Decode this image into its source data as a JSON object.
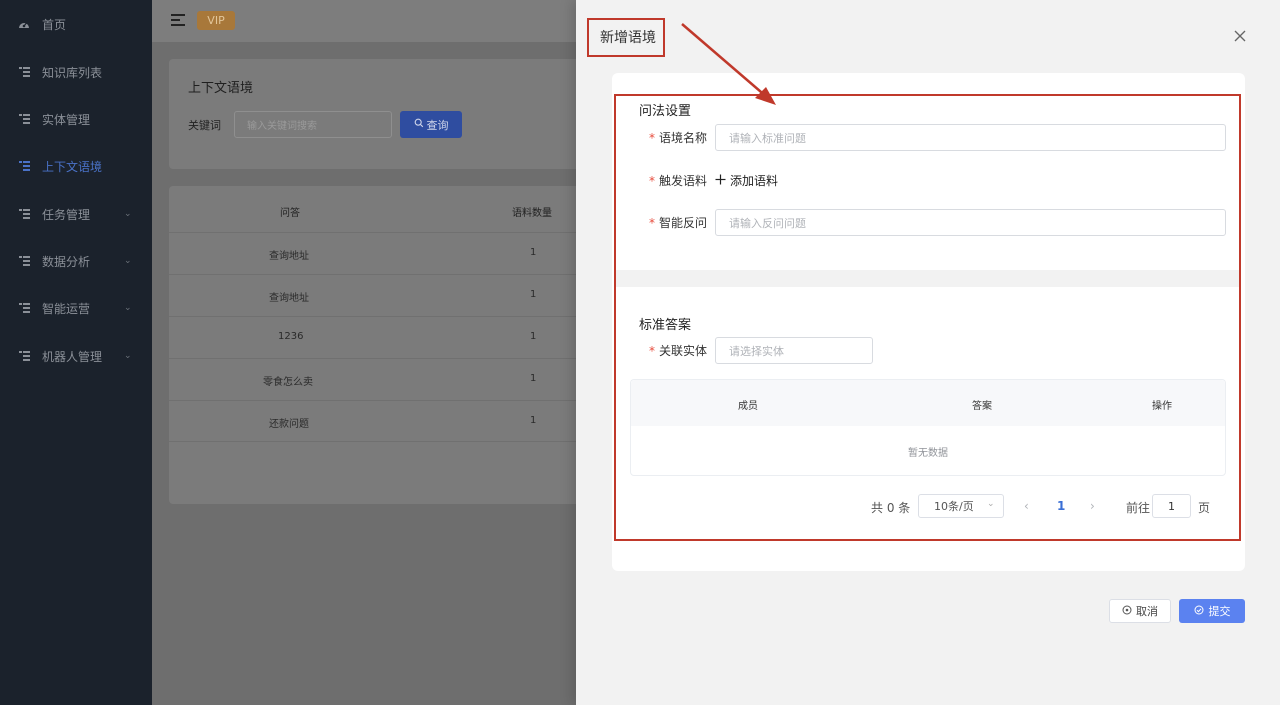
{
  "sidebar": {
    "items": [
      {
        "label": "首页",
        "icon": "dashboard-icon"
      },
      {
        "label": "知识库列表",
        "icon": "list-icon"
      },
      {
        "label": "实体管理",
        "icon": "list-icon"
      },
      {
        "label": "上下文语境",
        "icon": "list-icon",
        "active": true
      },
      {
        "label": "任务管理",
        "icon": "list-icon",
        "expandable": true
      },
      {
        "label": "数据分析",
        "icon": "list-icon",
        "expandable": true
      },
      {
        "label": "智能运营",
        "icon": "list-icon",
        "expandable": true
      },
      {
        "label": "机器人管理",
        "icon": "list-icon",
        "expandable": true
      }
    ]
  },
  "header": {
    "vip_label": "VIP"
  },
  "search_card": {
    "title": "上下文语境",
    "keyword_label": "关键词",
    "keyword_placeholder": "输入关键词搜索",
    "query_label": "查询"
  },
  "list_table": {
    "columns": [
      "问答",
      "语料数量"
    ],
    "rows": [
      [
        "查询地址",
        "1"
      ],
      [
        "查询地址",
        "1"
      ],
      [
        "1236",
        "1"
      ],
      [
        "零食怎么卖",
        "1"
      ],
      [
        "还款问题",
        "1"
      ]
    ]
  },
  "drawer": {
    "title": "新增语境",
    "grammar_section": "问法设置",
    "context_name_label": "语境名称",
    "context_name_placeholder": "请输入标准问题",
    "trigger_label": "触发语料",
    "add_corpus_label": "添加语料",
    "smart_ask_label": "智能反问",
    "smart_ask_placeholder": "请输入反问问题",
    "answer_section": "标准答案",
    "entity_label": "关联实体",
    "entity_placeholder": "请选择实体",
    "answer_table": {
      "columns": [
        "成员",
        "答案",
        "操作"
      ],
      "empty_text": "暂无数据"
    },
    "pagination": {
      "total": "共 0 条",
      "page_size": "10条/页",
      "current_page": "1",
      "goto_label": "前往",
      "goto_value": "1",
      "page_suffix": "页"
    },
    "cancel_label": "取消",
    "submit_label": "提交"
  },
  "colors": {
    "accent": "#5b82f0",
    "annotation_red": "#c0392b",
    "sidebar_bg": "#1b222c",
    "required_star": "#e74c3c"
  }
}
